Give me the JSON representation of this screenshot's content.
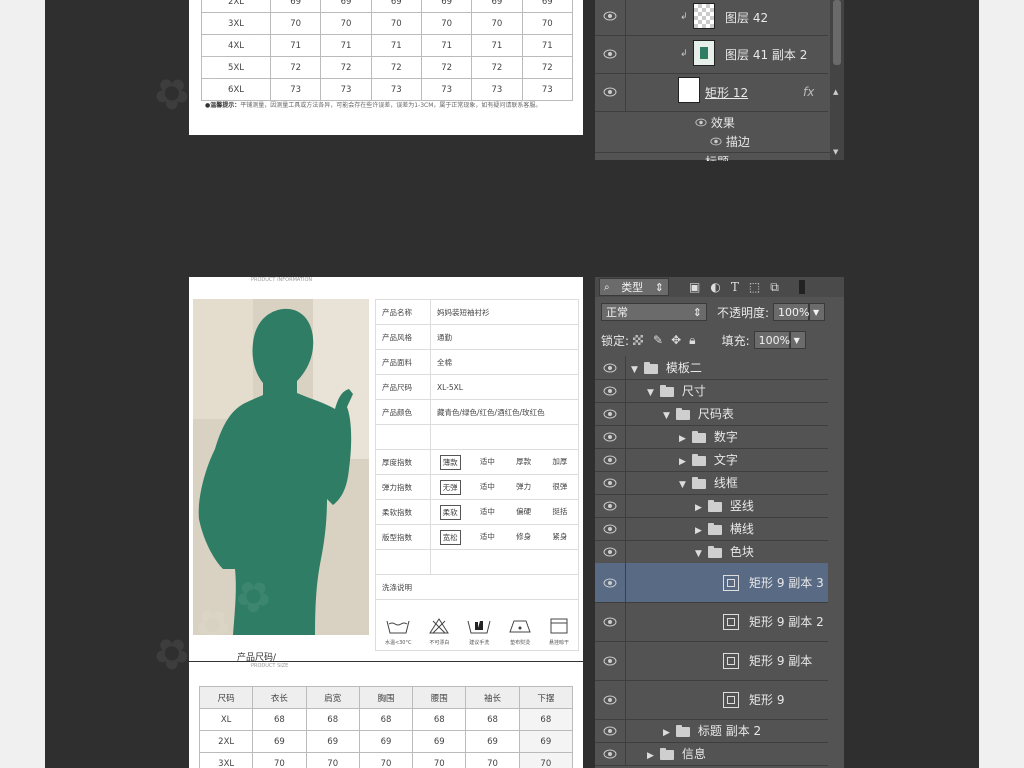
{
  "top_table": {
    "rows": [
      [
        "2XL",
        "69",
        "69",
        "69",
        "69",
        "69",
        "69"
      ],
      [
        "3XL",
        "70",
        "70",
        "70",
        "70",
        "70",
        "70"
      ],
      [
        "4XL",
        "71",
        "71",
        "71",
        "71",
        "71",
        "71"
      ],
      [
        "5XL",
        "72",
        "72",
        "72",
        "72",
        "72",
        "72"
      ],
      [
        "6XL",
        "73",
        "73",
        "73",
        "73",
        "73",
        "73"
      ]
    ],
    "tip_label": "●温馨提示：",
    "tip_text": "平铺测量，因测量工具或方法各异，可能会存在些许误差，误差为1-3CM，属于正常现象，如有疑问请联系客服。"
  },
  "product": {
    "header_sub": "PRODUCT INFORMATION",
    "info": [
      {
        "k": "产品名称",
        "v": "妈妈装短袖衬衫"
      },
      {
        "k": "产品风格",
        "v": "通勤"
      },
      {
        "k": "产品面料",
        "v": "全棉"
      },
      {
        "k": "产品尺码",
        "v": "XL-5XL"
      },
      {
        "k": "产品颜色",
        "v": "藏青色/绿色/红色/酒红色/玫红色"
      }
    ],
    "indices": [
      {
        "k": "厚度指数",
        "opts": [
          "薄款",
          "适中",
          "厚款",
          "加厚"
        ],
        "sel": 0
      },
      {
        "k": "弹力指数",
        "opts": [
          "无弹",
          "适中",
          "弹力",
          "很弹"
        ],
        "sel": 0
      },
      {
        "k": "柔软指数",
        "opts": [
          "柔软",
          "适中",
          "偏硬",
          "挺括"
        ],
        "sel": 0
      },
      {
        "k": "版型指数",
        "opts": [
          "宽松",
          "适中",
          "修身",
          "紧身"
        ],
        "sel": 0
      }
    ],
    "wash_label": "洗涤说明",
    "wash_icons": [
      "水温<30°C",
      "不可漂白",
      "建议手洗",
      "垫布熨烫",
      "悬挂晾干"
    ],
    "silhouette_color": "#2e7d64"
  },
  "size_section": {
    "title": "产品尺码/",
    "sub": "PRODUCT SIZE",
    "headers": [
      "尺码",
      "衣长",
      "肩宽",
      "胸围",
      "腰围",
      "袖长",
      "下摆"
    ],
    "rows": [
      [
        "XL",
        "68",
        "68",
        "68",
        "68",
        "68",
        "68"
      ],
      [
        "2XL",
        "69",
        "69",
        "69",
        "69",
        "69",
        "69"
      ],
      [
        "3XL",
        "70",
        "70",
        "70",
        "70",
        "70",
        "70"
      ]
    ]
  },
  "layers_top": {
    "rows": [
      {
        "name": "图层 42"
      },
      {
        "name": "图层 41 副本 2"
      },
      {
        "name": "矩形 12",
        "fx": "fx"
      }
    ],
    "effects_label": "效果",
    "stroke_label": "描边",
    "partial_label": "标题"
  },
  "layers_bottom": {
    "filter_label": "类型",
    "blend_mode": "正常",
    "opacity_label": "不透明度:",
    "opacity_value": "100%",
    "lock_label": "锁定:",
    "fill_label": "填充:",
    "fill_value": "100%",
    "tree": [
      {
        "name": "模板二",
        "depth": 0,
        "open": true,
        "type": "folder"
      },
      {
        "name": "尺寸",
        "depth": 1,
        "open": true,
        "type": "folder"
      },
      {
        "name": "尺码表",
        "depth": 2,
        "open": true,
        "type": "folder"
      },
      {
        "name": "数字",
        "depth": 3,
        "open": false,
        "type": "folder"
      },
      {
        "name": "文字",
        "depth": 3,
        "open": false,
        "type": "folder"
      },
      {
        "name": "线框",
        "depth": 3,
        "open": true,
        "type": "folder"
      },
      {
        "name": "竖线",
        "depth": 4,
        "open": false,
        "type": "folder"
      },
      {
        "name": "横线",
        "depth": 4,
        "open": false,
        "type": "folder"
      },
      {
        "name": "色块",
        "depth": 4,
        "open": true,
        "type": "folder"
      },
      {
        "name": "矩形 9 副本 3",
        "depth": 5,
        "type": "shape",
        "selected": true
      },
      {
        "name": "矩形 9 副本 2",
        "depth": 5,
        "type": "shape"
      },
      {
        "name": "矩形 9 副本",
        "depth": 5,
        "type": "shape"
      },
      {
        "name": "矩形 9",
        "depth": 5,
        "type": "shape"
      },
      {
        "name": "标题 副本 2",
        "depth": 2,
        "open": false,
        "type": "folder"
      },
      {
        "name": "信息",
        "depth": 1,
        "open": false,
        "type": "folder"
      }
    ]
  },
  "colors": {
    "panel_bg": "#535353",
    "selected_row": "#596a85",
    "canvas_bg": "#2f2f2f"
  }
}
